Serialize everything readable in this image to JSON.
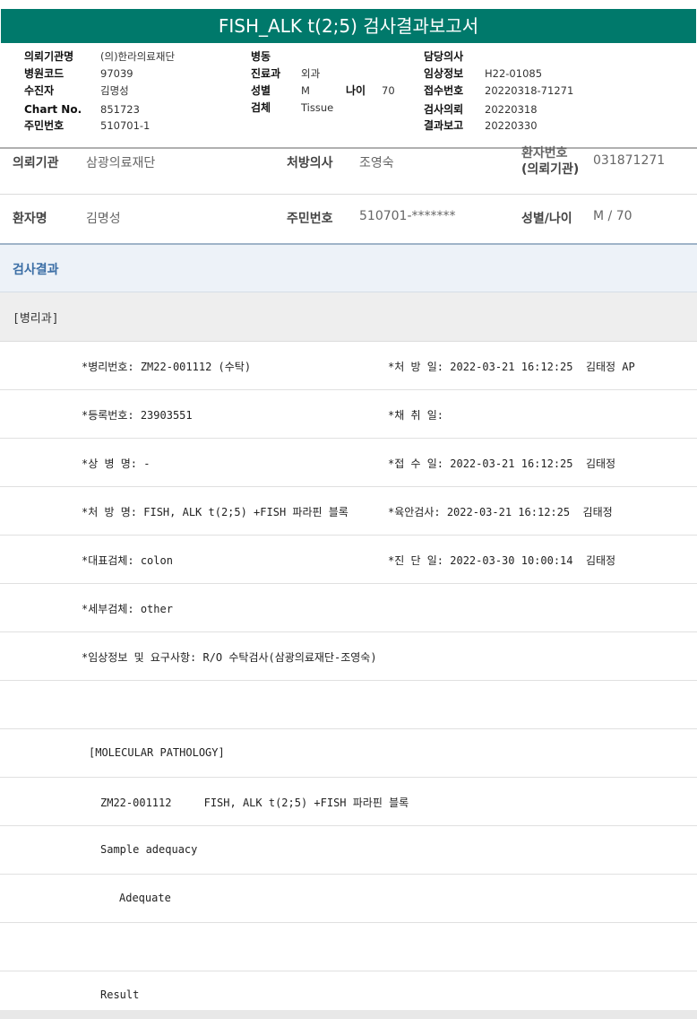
{
  "report": {
    "title": "FISH_ALK t(2;5) 검사결과보고서"
  },
  "info": {
    "institution_label": "의뢰기관명",
    "institution_value": "(의)한라의료재단",
    "hospital_code_label": "병원코드",
    "hospital_code_value": "97039",
    "patient_label": "수진자",
    "patient_value": "김명성",
    "chart_label": "Chart No.",
    "chart_value": "851723",
    "resident_label": "주민번호",
    "resident_value": "510701-1",
    "ward_label": "병동",
    "ward_value": "",
    "dept_label": "진료과",
    "dept_value": "외과",
    "sex_label": "성별",
    "sex_value": "M",
    "age_label": "나이",
    "age_value": "70",
    "specimen_label": "검체",
    "specimen_value": "Tissue",
    "doctor_label": "담당의사",
    "doctor_value": "",
    "clinical_label": "임상정보",
    "clinical_value": "H22-01085",
    "receipt_label": "접수번호",
    "receipt_value": "20220318-71271",
    "request_label": "검사의뢰",
    "request_value": "20220318",
    "result_label": "결과보고",
    "result_value": "20220330"
  },
  "header": {
    "inst_label": "의뢰기관",
    "inst_value": "삼광의료재단",
    "prescriber_label": "처방의사",
    "prescriber_value": "조영숙",
    "patient_no_label_1": "환자번호",
    "patient_no_label_2": "(의뢰기관)",
    "patient_no_value": "031871271",
    "name_label": "환자명",
    "name_value": "김명성",
    "rrn_label": "주민번호",
    "rrn_value": "510701-*******",
    "sexage_label": "성별/나이",
    "sexage_value": "M / 70"
  },
  "results": {
    "section_title": "검사결과",
    "department": "[병리과]",
    "rows": [
      {
        "left": "*병리번호: ZM22-001112 (수탁)",
        "right": "*처 방 일: 2022-03-21 16:12:25  김태정 AP"
      },
      {
        "left": "*등록번호: 23903551",
        "right": "*채 취 일:"
      },
      {
        "left": "*상 병 명: -",
        "right": "*접 수 일: 2022-03-21 16:12:25  김태정"
      },
      {
        "left": "*처 방 명: FISH, ALK t(2;5) +FISH 파라핀 블록",
        "right": "*육안검사: 2022-03-21 16:12:25  김태정"
      },
      {
        "left": "*대표검체: colon",
        "right": "*진 단 일: 2022-03-30 10:00:14  김태정"
      },
      {
        "left": "*세부검체: other",
        "right": ""
      },
      {
        "left": "*임상정보 및 요구사항: R/O 수탁검사(삼광의료재단-조영숙)",
        "right": ""
      },
      {
        "left": "",
        "right": ""
      },
      {
        "left": "[MOLECULAR PATHOLOGY]",
        "right": ""
      },
      {
        "left": "ZM22-001112     FISH, ALK t(2;5) +FISH 파라핀 블록",
        "right": ""
      },
      {
        "left": "Sample adequacy",
        "right": ""
      },
      {
        "left": "Adequate",
        "right": ""
      },
      {
        "left": "",
        "right": ""
      },
      {
        "left": "Result",
        "right": ""
      }
    ]
  }
}
